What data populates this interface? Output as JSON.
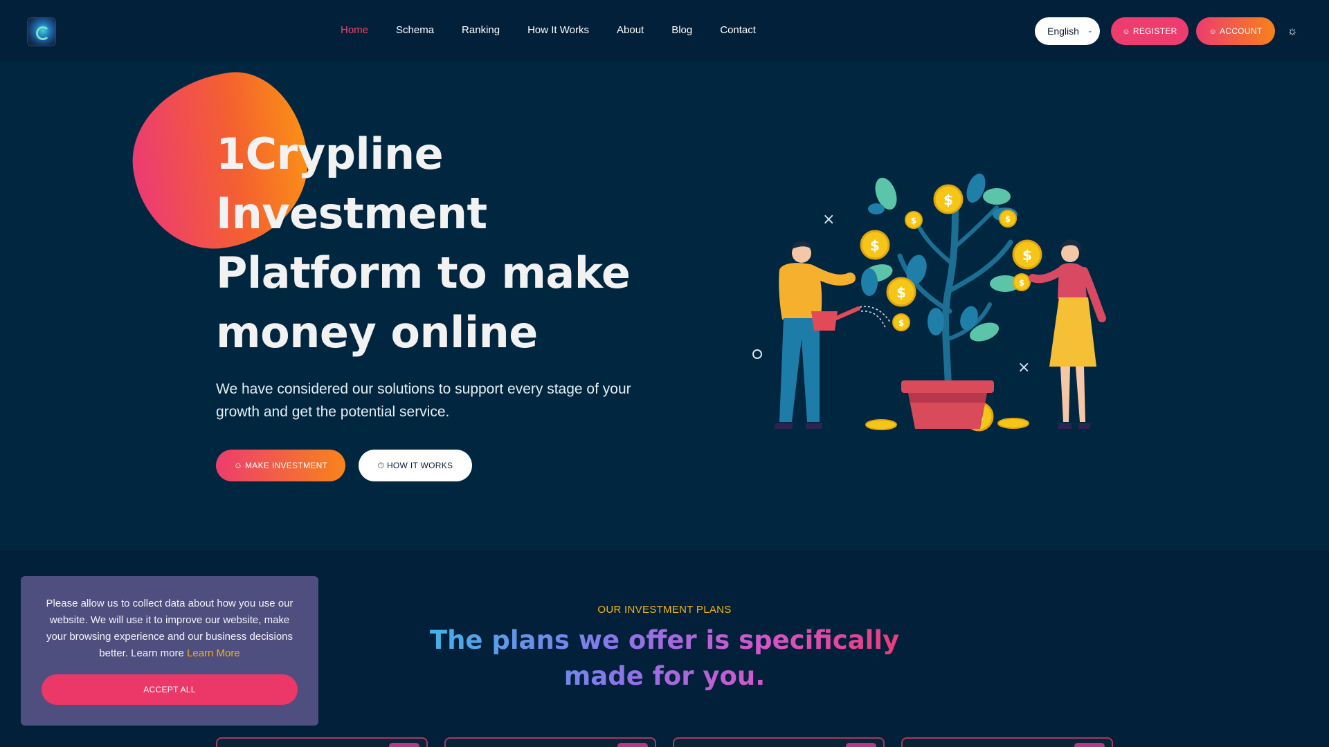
{
  "header": {
    "nav": [
      {
        "label": "Home",
        "active": true
      },
      {
        "label": "Schema"
      },
      {
        "label": "Ranking"
      },
      {
        "label": "How It Works"
      },
      {
        "label": "About"
      },
      {
        "label": "Blog"
      },
      {
        "label": "Contact"
      }
    ],
    "language": "English",
    "register_label": "REGISTER",
    "account_label": "ACCOUNT",
    "icons": {
      "user": "user-icon",
      "theme": "sun-icon",
      "chevron": "chevron-down-icon"
    }
  },
  "hero": {
    "title_lines": [
      "1Crypline",
      "Investment",
      "Platform to make",
      "money online"
    ],
    "subtitle": "We have considered our solutions to support every stage of your growth and get the potential service.",
    "invest_label": "MAKE INVESTMENT",
    "how_label": "HOW IT WORKS"
  },
  "plans": {
    "eyebrow": "OUR INVESTMENT PLANS",
    "heading": "The plans we offer is specifically made for you."
  },
  "cookie": {
    "text": "Please allow us to collect data about how you use our website. We will use it to improve our website, make your browsing experience and our business decisions better. Learn more",
    "learn_more": "Learn More",
    "accept_label": "ACCEPT ALL"
  },
  "colors": {
    "background": "#002640",
    "header": "#03203a",
    "accent_pink": "#ec3d6e",
    "accent_orange": "#f8821a",
    "active_nav": "#f0436e",
    "eyebrow": "#f5b50d",
    "cookie_bg": "#4f4f7f"
  }
}
